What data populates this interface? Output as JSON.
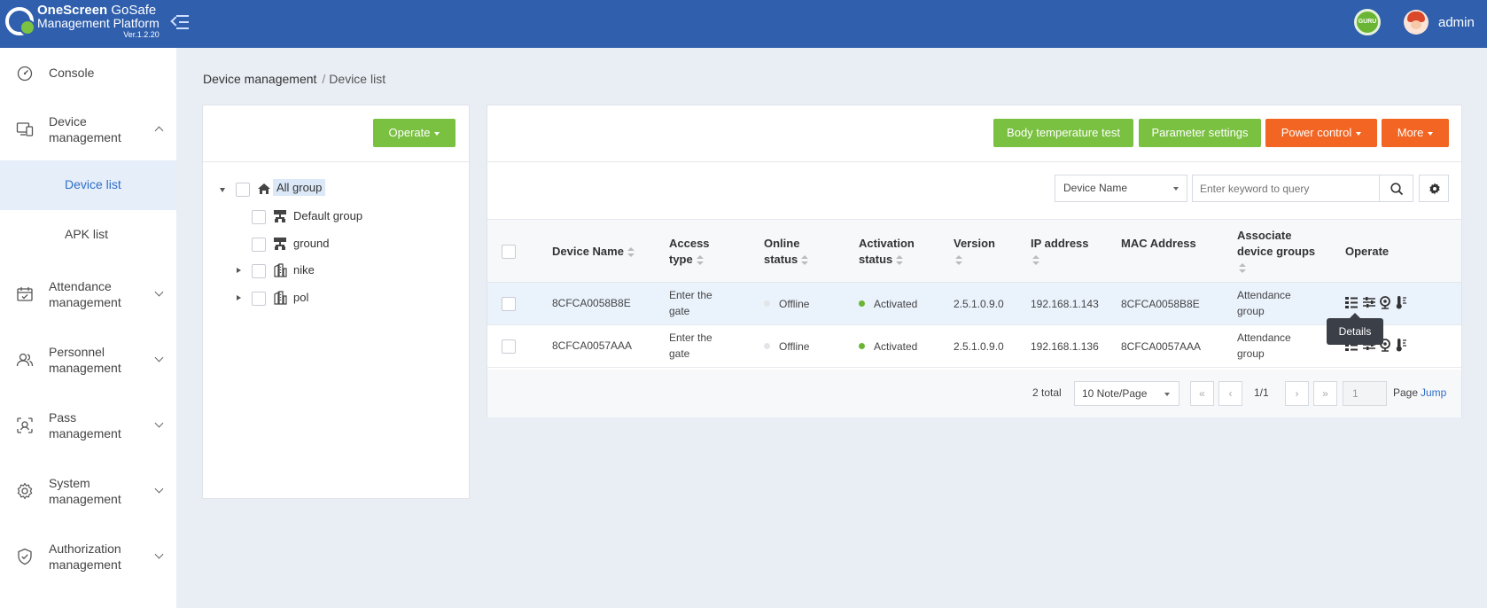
{
  "header": {
    "logo_name_bold": "OneScreen",
    "logo_name_rest": " GoSafe",
    "logo_subtitle": "Management Platform",
    "logo_version": "Ver.1.2.20",
    "guru_label": "GURU",
    "user": "admin",
    "brand_color": "#2f5fad"
  },
  "sidebar": {
    "items": [
      {
        "label": "Console",
        "icon": "dashboard-icon"
      },
      {
        "label": "Device\nmanagement",
        "icon": "devices-icon",
        "expanded": true
      },
      {
        "label": "Device list",
        "active": true
      },
      {
        "label": "APK list"
      },
      {
        "label": "Attendance\nmanagement",
        "icon": "calendar-check-icon"
      },
      {
        "label": "Personnel\nmanagement",
        "icon": "people-icon"
      },
      {
        "label": "Pass\nmanagement",
        "icon": "face-scan-icon"
      },
      {
        "label": "System\nmanagement",
        "icon": "gear-icon"
      },
      {
        "label": "Authorization\nmanagement",
        "icon": "shield-check-icon"
      }
    ]
  },
  "breadcrumb": {
    "parent": "Device management",
    "sep": "/",
    "current": "Device list"
  },
  "group_panel": {
    "operate_label": "Operate",
    "tree": [
      {
        "label": "All group",
        "icon": "home-icon",
        "selected": true
      },
      {
        "label": "Default group",
        "icon": "org-chart-icon"
      },
      {
        "label": "ground",
        "icon": "org-chart-icon"
      },
      {
        "label": "nike",
        "icon": "building-icon"
      },
      {
        "label": "pol",
        "icon": "building-icon"
      }
    ]
  },
  "toolbar": {
    "body_temp_label": "Body temperature test",
    "param_settings_label": "Parameter settings",
    "power_control_label": "Power control",
    "more_label": "More",
    "accent_green": "#7ac142",
    "accent_orange": "#f26522"
  },
  "filter": {
    "field_selected": "Device Name",
    "search_placeholder": "Enter keyword to query"
  },
  "table": {
    "headers": {
      "device_name": "Device Name",
      "access_type": "Access\ntype",
      "online_status": "Online\nstatus",
      "activation_status": "Activation\nstatus",
      "version": "Version",
      "ip": "IP address",
      "mac": "MAC Address",
      "groups": "Associate\ndevice groups",
      "operate": "Operate"
    },
    "rows": [
      {
        "device_name": "8CFCA0058B8E",
        "access_type": "Enter the\ngate",
        "online": "Offline",
        "activation": "Activated",
        "version": "2.5.1.0.9.0",
        "ip": "192.168.1.143",
        "mac": "8CFCA0058B8E",
        "group": "Attendance\ngroup"
      },
      {
        "device_name": "8CFCA0057AAA",
        "access_type": "Enter the\ngate",
        "online": "Offline",
        "activation": "Activated",
        "version": "2.5.1.0.9.0",
        "ip": "192.168.1.136",
        "mac": "8CFCA0057AAA",
        "group": "Attendance\ngroup"
      }
    ],
    "tooltip": "Details"
  },
  "pagination": {
    "total": "2 total",
    "page_size": "10 Note/Page",
    "first": "«",
    "prev": "‹",
    "current": "1/1",
    "next": "›",
    "last": "»",
    "jump_value": "1",
    "page_label": "Page",
    "jump_label": "Jump"
  }
}
